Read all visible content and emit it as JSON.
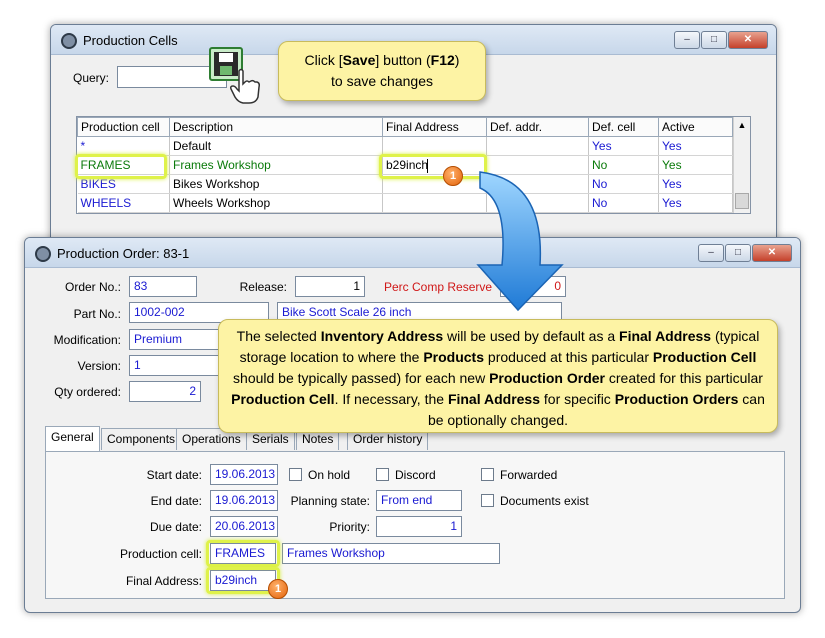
{
  "cells_window": {
    "title": "Production Cells",
    "window_buttons": {
      "minimize": "–",
      "maximize": "□",
      "close": "✕"
    },
    "query_label": "Query:",
    "query_value": "",
    "columns": [
      "Production cell",
      "Description",
      "Final Address",
      "Def. addr.",
      "Def. cell",
      "Active"
    ],
    "rows": [
      {
        "cell": "*",
        "description": "Default",
        "final_address": "",
        "def_addr": "",
        "def_cell": "Yes",
        "active": "Yes"
      },
      {
        "cell": "FRAMES",
        "description": "Frames Workshop",
        "final_address": "b29inch",
        "def_addr": "",
        "def_cell": "No",
        "active": "Yes"
      },
      {
        "cell": "BIKES",
        "description": "Bikes Workshop",
        "final_address": "",
        "def_addr": "",
        "def_cell": "No",
        "active": "Yes"
      },
      {
        "cell": "WHEELS",
        "description": "Wheels Workshop",
        "final_address": "",
        "def_addr": "",
        "def_cell": "No",
        "active": "Yes"
      }
    ]
  },
  "save_callout": {
    "prefix": "Click [",
    "save_word": "Save",
    "middle": "] button (",
    "key": "F12",
    "suffix": ")",
    "line2": "to save changes"
  },
  "order_window": {
    "title": "Production Order: 83-1",
    "window_buttons": {
      "minimize": "–",
      "maximize": "□",
      "close": "✕"
    },
    "order_no_label": "Order No.:",
    "order_no": "83",
    "release_label": "Release:",
    "release": "1",
    "perc_label": "Perc Comp Reserve",
    "perc_value": "0",
    "part_no_label": "Part No.:",
    "part_no": "1002-002",
    "part_desc": "Bike Scott Scale 26 inch",
    "modification_label": "Modification:",
    "modification": "Premium",
    "version_label": "Version:",
    "version": "1",
    "qty_label": "Qty ordered:",
    "qty": "2",
    "tabs": [
      "General",
      "Components",
      "Operations",
      "Serials",
      "Notes",
      "Order history"
    ],
    "general": {
      "start_date_label": "Start date:",
      "start_date": "19.06.2013",
      "end_date_label": "End date:",
      "end_date": "19.06.2013",
      "due_date_label": "Due date:",
      "due_date": "20.06.2013",
      "on_hold_label": "On hold",
      "discord_label": "Discord",
      "forwarded_label": "Forwarded",
      "documents_exist_label": "Documents exist",
      "planning_state_label": "Planning state:",
      "planning_state": "From end",
      "priority_label": "Priority:",
      "priority": "1",
      "production_cell_label": "Production cell:",
      "production_cell": "FRAMES",
      "production_cell_desc": "Frames Workshop",
      "final_address_label": "Final Address:",
      "final_address": "b29inch"
    }
  },
  "info_callout": {
    "p1": "The selected ",
    "b1": "Inventory Address",
    "p2": " will be used by default as a ",
    "b2": "Final Address",
    "p3": " (typical storage location to where the ",
    "b3": "Products",
    "p4": " produced at this particular ",
    "b4": "Production Cell",
    "p5": " should be typically passed) for each new ",
    "b5": "Production Order",
    "p6": " created for this particular ",
    "b6": "Production Cell",
    "p7": ".  If necessary, the ",
    "b7": "Final Address",
    "p8": " for specific ",
    "b8": "Production  Orders",
    "p9": " can be optionally changed."
  },
  "badge_number": "1",
  "colors": {
    "highlight": "#dff24a",
    "callout_bg": "#fdf3a4",
    "arrow": "#2f8fe0",
    "badge": "#e3620a"
  }
}
